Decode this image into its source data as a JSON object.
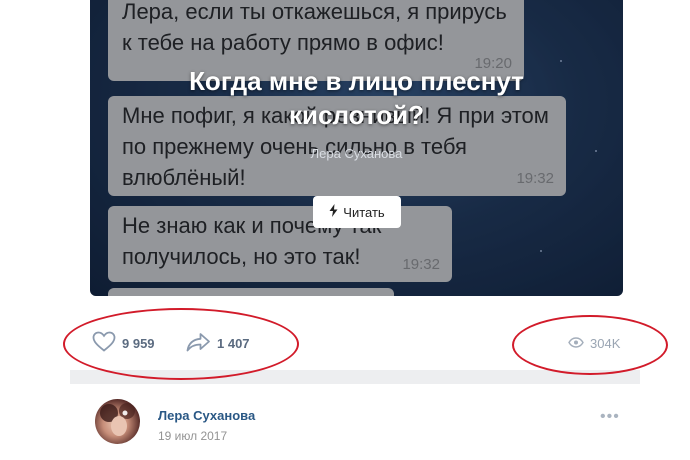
{
  "article": {
    "bubbles": [
      {
        "text": "Лера, если ты откажешься, я прирусь к тебе на работу прямо в офис!",
        "time": "19:20"
      },
      {
        "text": "Мне пофиг, я какой ревнивый! Я при этом по прежнему очень сильно в тебя влюблёный!",
        "time": "19:32"
      },
      {
        "text": "Не знаю как и почему так получилось, но это так!",
        "time": "19:32"
      }
    ],
    "title": "Когда мне в лицо плеснут кислотой?",
    "author": "Лера Суханова",
    "read_label": "Читать",
    "read_icon": "lightning-icon"
  },
  "stats": {
    "likes": "9 959",
    "shares": "1 407",
    "views": "304K",
    "like_icon": "heart-icon",
    "share_icon": "share-arrow-icon",
    "views_icon": "eye-icon"
  },
  "annotation_color": "#d21b2a",
  "post": {
    "author": "Лера Суханова",
    "date": "19 июл 2017",
    "more_label": "•••"
  }
}
